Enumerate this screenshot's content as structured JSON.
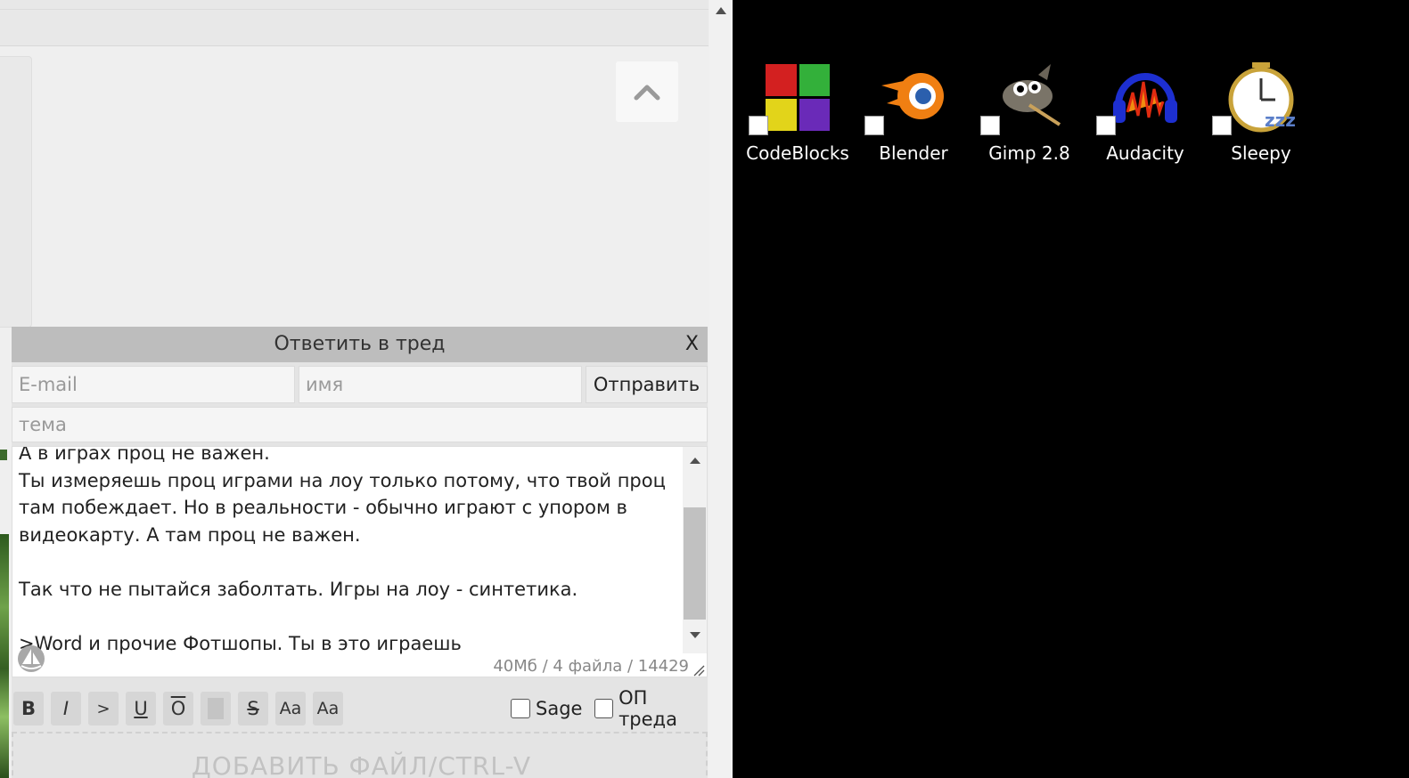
{
  "reply_form": {
    "title": "Ответить в тред",
    "close_label": "X",
    "email_placeholder": "E-mail",
    "name_placeholder": "имя",
    "subject_placeholder": "тема",
    "send_label": "Отправить",
    "message": "А в играх проц не важен.\nТы измеряешь проц играми на лоу только потому, что твой проц там побеждает. Но в реальности - обычно играют с упором в видеокарту. А там проц не важен.\n\nТак что не пытайся заболтать. Игры на лоу - синтетика.\n\n>Word и прочие Фотшопы. Ты в это играешь",
    "limits": "40Мб / 4 файла / 14429",
    "format_buttons": [
      {
        "label": "B",
        "action": "bold"
      },
      {
        "label": "I",
        "action": "italic"
      },
      {
        "label": ">",
        "action": "quote"
      },
      {
        "label": "U",
        "action": "underline"
      },
      {
        "label": "O",
        "action": "overline"
      },
      {
        "label": "",
        "action": "spoiler"
      },
      {
        "label": "S",
        "action": "strike"
      },
      {
        "label": "Aa",
        "action": "superscript"
      },
      {
        "label": "Aa",
        "action": "subscript"
      }
    ],
    "sage_label": "Sage",
    "op_label": "ОП треда",
    "dropzone_label": "ДОБАВИТЬ ФАЙЛ/CTRL-V"
  },
  "desktop": {
    "icons": [
      {
        "label": "CodeBlocks",
        "icon": "codeblocks-icon"
      },
      {
        "label": "Blender",
        "icon": "blender-icon"
      },
      {
        "label": "Gimp 2.8",
        "icon": "gimp-icon"
      },
      {
        "label": "Audacity",
        "icon": "audacity-icon"
      },
      {
        "label": "Sleepy",
        "icon": "sleepy-icon"
      }
    ]
  },
  "colors": {
    "page_bg": "#efefef",
    "reply_header": "#bdbdbd",
    "desktop_bg": "#000000"
  }
}
